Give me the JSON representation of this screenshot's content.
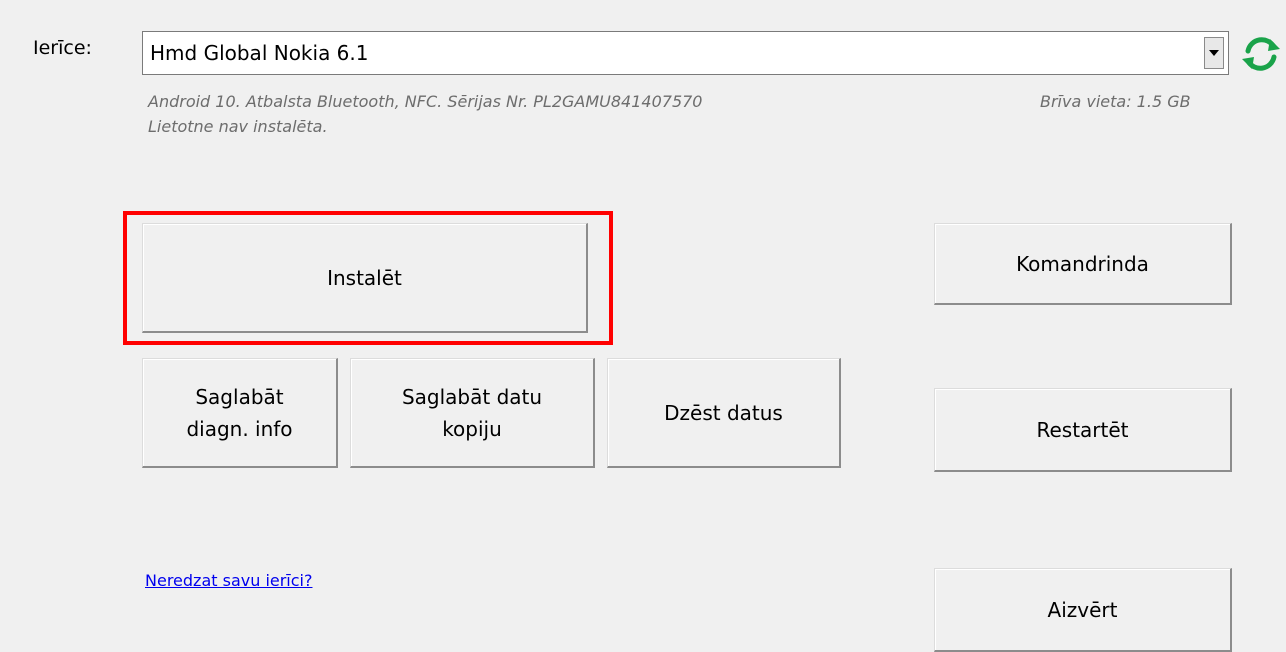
{
  "device": {
    "label": "Ierīce:",
    "selected": "Hmd Global Nokia 6.1",
    "info_line1": "Android 10. Atbalsta Bluetooth, NFC.  Sērijas Nr. PL2GAMU841407570",
    "info_line2": "Lietotne nav instalēta.",
    "free_space": "Brīva vieta: 1.5 GB"
  },
  "buttons": {
    "install": "Instalēt",
    "save_diag": "Saglabāt\ndiagn. info",
    "save_backup": "Saglabāt datu\nkopiju",
    "delete_data": "Dzēst datus",
    "command_line": "Komandrinda",
    "restart": "Restartēt",
    "close": "Aizvērt"
  },
  "links": {
    "cant_see_device": "Neredzat savu ierīci?"
  },
  "colors": {
    "highlight": "#ff0000",
    "refresh_icon": "#1aa34a",
    "link": "#0000ee"
  },
  "icons": {
    "refresh": "refresh-icon",
    "dropdown": "chevron-down-icon"
  }
}
